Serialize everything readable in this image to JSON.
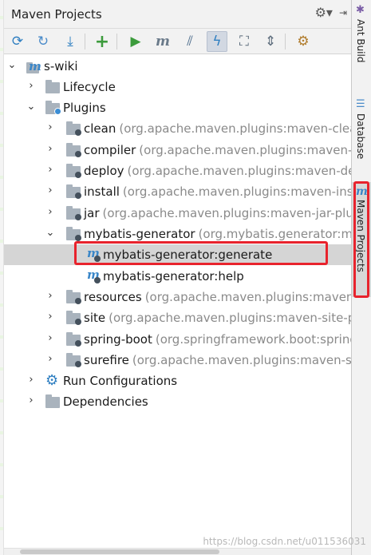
{
  "window": {
    "title": "Maven Projects",
    "title_tools": {
      "gear": "⚙▾",
      "hide": "⇥"
    }
  },
  "toolbar": {
    "buttons": [
      {
        "name": "reimport-icon",
        "glyph": "⟳",
        "color": "#2f7fc1"
      },
      {
        "name": "generate-sources-icon",
        "glyph": "↻",
        "color": "#4a8bc9"
      },
      {
        "name": "download-icon",
        "glyph": "⤓",
        "color": "#2f7fc1"
      },
      {
        "name": "add-icon",
        "glyph": "+",
        "color": "#3c9b3c"
      },
      {
        "name": "run-icon",
        "glyph": "▶",
        "color": "#3c9b3c"
      },
      {
        "name": "execute-goal-icon",
        "glyph": "m",
        "color": "#6a7a8a"
      },
      {
        "name": "toggle-offline-icon",
        "glyph": "⫽",
        "color": "#4a6a8a"
      },
      {
        "name": "skip-tests-icon",
        "glyph": "ϟ",
        "color": "#2f7fc1"
      },
      {
        "name": "show-dependencies-icon",
        "glyph": "⛶",
        "color": "#5a6a7a"
      },
      {
        "name": "collapse-all-icon",
        "glyph": "⇕",
        "color": "#5a6a7a"
      },
      {
        "name": "settings-icon",
        "glyph": "⚙",
        "color": "#b07b2a"
      }
    ]
  },
  "tree": {
    "rows": [
      {
        "text": "s-wiki",
        "suffix": ""
      },
      {
        "text": "Lifecycle",
        "suffix": ""
      },
      {
        "text": "Plugins",
        "suffix": ""
      },
      {
        "text": "clean",
        "suffix": "(org.apache.maven.plugins:maven-clean-"
      },
      {
        "text": "compiler",
        "suffix": "(org.apache.maven.plugins:maven-co"
      },
      {
        "text": "deploy",
        "suffix": "(org.apache.maven.plugins:maven-dep"
      },
      {
        "text": "install",
        "suffix": "(org.apache.maven.plugins:maven-insta"
      },
      {
        "text": "jar",
        "suffix": "(org.apache.maven.plugins:maven-jar-plugi"
      },
      {
        "text": "mybatis-generator",
        "suffix": "(org.mybatis.generator:my"
      },
      {
        "text": "mybatis-generator:generate",
        "suffix": ""
      },
      {
        "text": "mybatis-generator:help",
        "suffix": ""
      },
      {
        "text": "resources",
        "suffix": "(org.apache.maven.plugins:maven-r"
      },
      {
        "text": "site",
        "suffix": "(org.apache.maven.plugins:maven-site-plu"
      },
      {
        "text": "spring-boot",
        "suffix": "(org.springframework.boot:spring"
      },
      {
        "text": "surefire",
        "suffix": "(org.apache.maven.plugins:maven-sur"
      },
      {
        "text": "Run Configurations",
        "suffix": ""
      },
      {
        "text": "Dependencies",
        "suffix": ""
      }
    ]
  },
  "side_tabs": [
    {
      "label": "Ant Build"
    },
    {
      "label": "Database"
    },
    {
      "label": "Maven Projects"
    }
  ],
  "watermark": "https://blog.csdn.net/u011536031",
  "colors": {
    "highlight_border": "#e8232d",
    "selected_row": "#d5d5d5",
    "maven_blue": "#3a86c8"
  }
}
